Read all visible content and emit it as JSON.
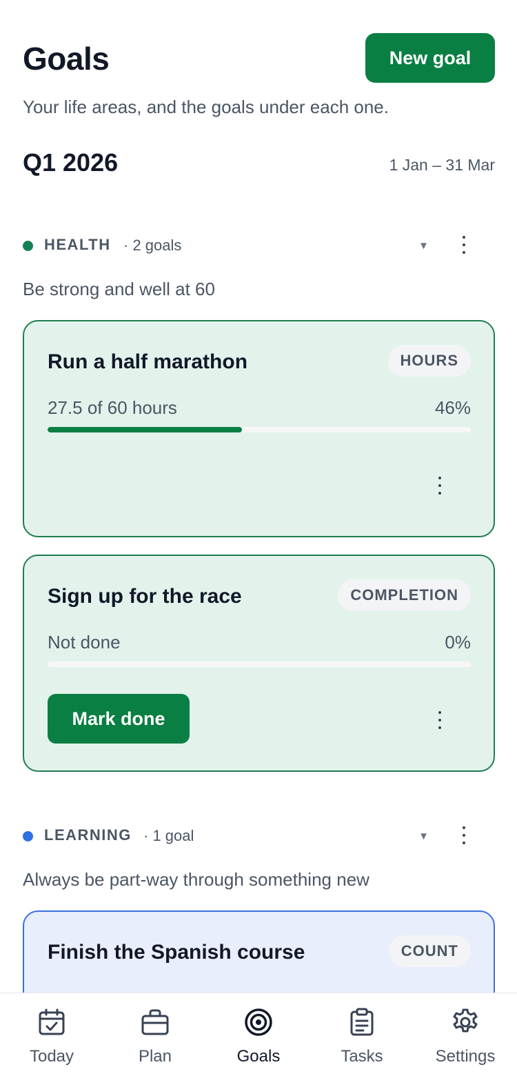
{
  "header": {
    "title": "Goals",
    "new_goal_label": "New goal",
    "subtitle": "Your life areas, and the goals under each one."
  },
  "quarter": {
    "label": "Q1 2026",
    "range": "1 Jan – 31 Mar"
  },
  "areas": [
    {
      "name": "HEALTH",
      "count": "· 2 goals",
      "color": "#168054",
      "description": "Be strong and well at 60",
      "goals": [
        {
          "title": "Run a half marathon",
          "tag": "HOURS",
          "progress_text": "27.5 of 60 hours",
          "percent_label": "46%",
          "progress": 46
        },
        {
          "title": "Sign up for the race",
          "tag": "COMPLETION",
          "progress_text": "Not done",
          "percent_label": "0%",
          "progress": 0,
          "action_label": "Mark done"
        }
      ]
    },
    {
      "name": "LEARNING",
      "count": "· 1 goal",
      "color": "#2f6fe6",
      "description": "Always be part-way through something new",
      "goals": [
        {
          "title": "Finish the Spanish course",
          "tag": "COUNT"
        }
      ]
    }
  ],
  "tabs": [
    {
      "label": "Today",
      "icon": "calendar-check-icon"
    },
    {
      "label": "Plan",
      "icon": "briefcase-icon"
    },
    {
      "label": "Goals",
      "icon": "target-icon",
      "active": true
    },
    {
      "label": "Tasks",
      "icon": "clipboard-icon"
    },
    {
      "label": "Settings",
      "icon": "gear-icon"
    }
  ],
  "colors": {
    "accent": "#0a7f43",
    "health_card_bg": "#e3f3ec",
    "learning_card_bg": "#e8eefc"
  }
}
